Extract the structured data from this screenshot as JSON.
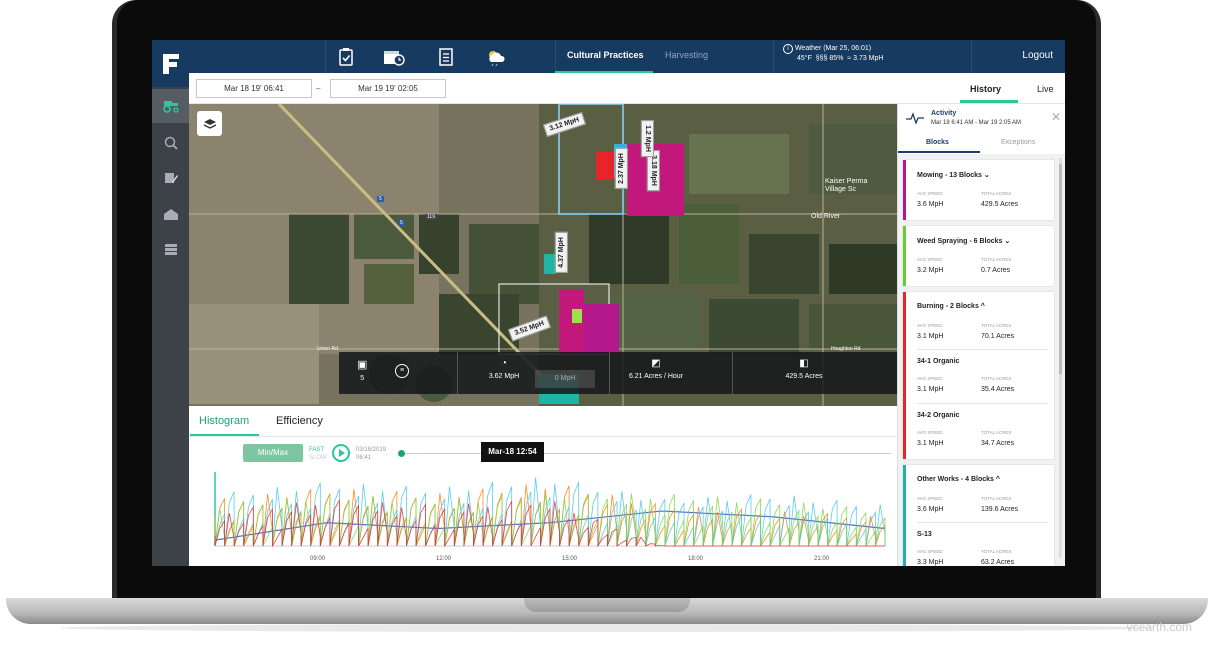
{
  "colors": {
    "navy": "#173a61",
    "accent": "#2bc89a",
    "nav_bg": "#3c4248",
    "mowing": "#b5178c",
    "spraying": "#66cc33",
    "burning": "#e8232a",
    "other": "#1fb5a5"
  },
  "left_nav": {
    "icons": [
      "logo-icon",
      "tractor-icon",
      "search-icon",
      "pencil-icon",
      "barn-icon",
      "stack-icon"
    ]
  },
  "topbar": {
    "icons": [
      "clipboard-check-icon",
      "calendar-clock-icon",
      "checklist-icon",
      "weather-icon"
    ],
    "tabs": [
      {
        "label": "Cultural Practices",
        "active": true
      },
      {
        "label": "Harvesting",
        "active": false
      }
    ],
    "weather": {
      "title": "Weather (Mar 25, 06:01)",
      "temp": "45°F",
      "humidity": "85%",
      "wind": "3.73 MpH"
    },
    "logout": "Logout"
  },
  "datebar": {
    "start": "Mar 18 19' 06:41",
    "sep": "–",
    "end": "Mar 19 19' 02:05",
    "tabs": [
      {
        "label": "History",
        "active": true
      },
      {
        "label": "Live",
        "active": false
      }
    ]
  },
  "map": {
    "speed_tags": [
      "3.12 MpH",
      "2.37 MpH",
      "3.18 MpH",
      "1.2 MpH",
      "4.37 MpH",
      "3.52 MpH"
    ],
    "place_labels": [
      "Kaiser Perma Village Sc",
      "Old River",
      "Union Rd",
      "Houghton Rd"
    ],
    "road_labels": [
      "5",
      "5",
      "119"
    ],
    "stats": {
      "vehicles": "5",
      "speed": "3.62 MpH",
      "idle": "0 MpH",
      "rate": "6.21 Acres / Hour",
      "acres": "429.5 Acres"
    }
  },
  "chart": {
    "tabs": [
      {
        "label": "Histogram",
        "active": true
      },
      {
        "label": "Efficiency",
        "active": false
      }
    ],
    "minmax": "Min/Max",
    "fast": "FAST",
    "fast_sub": "SLOW",
    "start_date": "03/18/2019",
    "start_time": "06:41",
    "tooltip": "Mar-18 12:54",
    "xticks": [
      "09:00",
      "12:00",
      "15:00",
      "18:00",
      "21:00"
    ]
  },
  "chart_data": {
    "type": "line",
    "title": "",
    "xlabel": "",
    "ylabel": "",
    "x": [
      "06:41",
      "09:00",
      "12:00",
      "15:00",
      "18:00",
      "21:00",
      "02:05"
    ],
    "series": [
      {
        "values": [
          1,
          4,
          3,
          4,
          6,
          5,
          3
        ],
        "color": "#4a6fd6"
      },
      {
        "values": [
          8,
          10,
          9,
          11,
          7,
          6,
          5
        ],
        "color": "#ff7a00"
      },
      {
        "values": [
          9,
          11,
          10,
          12,
          8,
          9,
          7
        ],
        "color": "#3dc4e8"
      },
      {
        "values": [
          7,
          9,
          8,
          9,
          9,
          8,
          6
        ],
        "color": "#7ad43c"
      },
      {
        "values": [
          6,
          8,
          7,
          8,
          0,
          0,
          0
        ],
        "color": "#e8232a"
      }
    ]
  },
  "panel": {
    "title": "Activity",
    "range": "Mar 18 6:41 AM - Mar 19 2:05 AM",
    "tabs": [
      {
        "label": "Blocks",
        "active": true
      },
      {
        "label": "Exceptions",
        "active": false
      }
    ],
    "avg_label": "AVG SPEED",
    "acres_label": "TOTAL ACRES",
    "groups": [
      {
        "title": "Mowing - 13 Blocks",
        "chevron": "⌄",
        "color": "#b5178c",
        "rows": [
          {
            "name": "",
            "speed": "3.6 MpH",
            "acres": "429.5 Acres"
          }
        ]
      },
      {
        "title": "Weed Spraying - 6 Blocks",
        "chevron": "⌄",
        "color": "#66cc33",
        "rows": [
          {
            "name": "",
            "speed": "3.2 MpH",
            "acres": "0.7 Acres"
          }
        ]
      },
      {
        "title": "Burning - 2 Blocks",
        "chevron": "^",
        "color": "#e8232a",
        "rows": [
          {
            "name": "",
            "speed": "3.1 MpH",
            "acres": "70.1 Acres"
          },
          {
            "name": "34-1 Organic",
            "speed": "3.1 MpH",
            "acres": "35.4 Acres"
          },
          {
            "name": "34-2 Organic",
            "speed": "3.1 MpH",
            "acres": "34.7 Acres"
          }
        ]
      },
      {
        "title": "Other Works - 4 Blocks",
        "chevron": "^",
        "color": "#1fb5a5",
        "rows": [
          {
            "name": "",
            "speed": "3.6 MpH",
            "acres": "139.6 Acres"
          },
          {
            "name": "S-13",
            "speed": "3.3 MpH",
            "acres": "63.2 Acres"
          }
        ]
      }
    ]
  },
  "watermark": "vcearth.com"
}
